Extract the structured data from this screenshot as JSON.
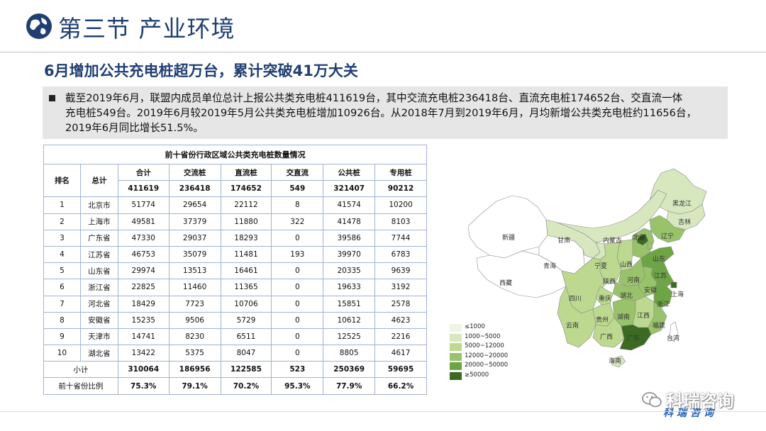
{
  "header": {
    "section_title": "第三节 产业环境"
  },
  "headline": "6月增加公共充电桩超万台，累计突破41万大关",
  "summary": {
    "line1": "截至2019年6月，联盟内成员单位总计上报公共类充电桩411619台，其中交流充电桩236418台、直流充电桩174652台、交直流一体",
    "line2": "充电桩549台。2019年6月较2019年5月公共类充电桩增加10926台。从2018年7月到2019年6月，月均新增公共类充电桩约11656台，",
    "line3": "2019年6月同比增长51.5%。"
  },
  "table": {
    "title": "前十省份行政区域公共类充电桩数量情况",
    "col_rank": "排名",
    "col_total_label": "总计",
    "columns": [
      "合计",
      "交流桩",
      "直流桩",
      "交直流",
      "公共桩",
      "专用桩"
    ],
    "totals": [
      "411619",
      "236418",
      "174652",
      "549",
      "321407",
      "90212"
    ],
    "rows": [
      {
        "rank": "1",
        "region": "北京市",
        "values": [
          "51774",
          "29654",
          "22112",
          "8",
          "41574",
          "10200"
        ]
      },
      {
        "rank": "2",
        "region": "上海市",
        "values": [
          "49581",
          "37379",
          "11880",
          "322",
          "41478",
          "8103"
        ]
      },
      {
        "rank": "3",
        "region": "广东省",
        "values": [
          "47330",
          "29037",
          "18293",
          "0",
          "39586",
          "7744"
        ]
      },
      {
        "rank": "4",
        "region": "江苏省",
        "values": [
          "46753",
          "35079",
          "11481",
          "193",
          "39970",
          "6783"
        ]
      },
      {
        "rank": "5",
        "region": "山东省",
        "values": [
          "29974",
          "13513",
          "16461",
          "0",
          "20335",
          "9639"
        ]
      },
      {
        "rank": "6",
        "region": "浙江省",
        "values": [
          "22825",
          "11460",
          "11365",
          "0",
          "19633",
          "3192"
        ]
      },
      {
        "rank": "7",
        "region": "河北省",
        "values": [
          "18429",
          "7723",
          "10706",
          "0",
          "15851",
          "2578"
        ]
      },
      {
        "rank": "8",
        "region": "安徽省",
        "values": [
          "15235",
          "9506",
          "5729",
          "0",
          "10612",
          "4623"
        ]
      },
      {
        "rank": "9",
        "region": "天津市",
        "values": [
          "14741",
          "8230",
          "6511",
          "0",
          "12525",
          "2216"
        ]
      },
      {
        "rank": "10",
        "region": "湖北省",
        "values": [
          "13422",
          "5375",
          "8047",
          "0",
          "8805",
          "4617"
        ]
      }
    ],
    "subtotal_label": "小计",
    "subtotal": [
      "310064",
      "186956",
      "122585",
      "523",
      "250369",
      "59695"
    ],
    "ratio_label": "前十省份比例",
    "ratio": [
      "75.3%",
      "79.1%",
      "70.2%",
      "95.3%",
      "77.9%",
      "66.2%"
    ]
  },
  "map": {
    "labels": {
      "xinjiang": "新疆",
      "xizang": "西藏",
      "qinghai": "青海",
      "gansu": "甘肃",
      "neimenggu": "内蒙古",
      "heilongjiang": "黑龙江",
      "jilin": "吉林",
      "liaoning": "辽宁",
      "beijing": "北京",
      "ningxia": "宁夏",
      "shanxi": "山西",
      "shandong": "山东",
      "shaanxi": "陕西",
      "henan": "河南",
      "jiangsu": "江苏",
      "anhui": "安徽",
      "shanghai": "上海",
      "sichuan": "四川",
      "chongqing": "重庆",
      "hubei": "湖北",
      "zhejiang": "浙江",
      "guizhou": "贵州",
      "hunan": "湖南",
      "jiangxi": "江西",
      "yunnan": "云南",
      "guangxi": "广西",
      "guangdong": "广东",
      "fujian": "福建",
      "taiwan": "台湾",
      "hainan": "海南"
    },
    "legend": [
      {
        "label": "≤1000",
        "color": "#eef5e4"
      },
      {
        "label": "1000~5000",
        "color": "#d7e8bf"
      },
      {
        "label": "5000~12000",
        "color": "#bcd98f"
      },
      {
        "label": "12000~20000",
        "color": "#98c36b"
      },
      {
        "label": "20000~50000",
        "color": "#6ea544"
      },
      {
        "label": "≥50000",
        "color": "#3b6b23"
      }
    ]
  },
  "logo": {
    "name": "科瑞咨询",
    "sub": "科瑞咨询"
  }
}
